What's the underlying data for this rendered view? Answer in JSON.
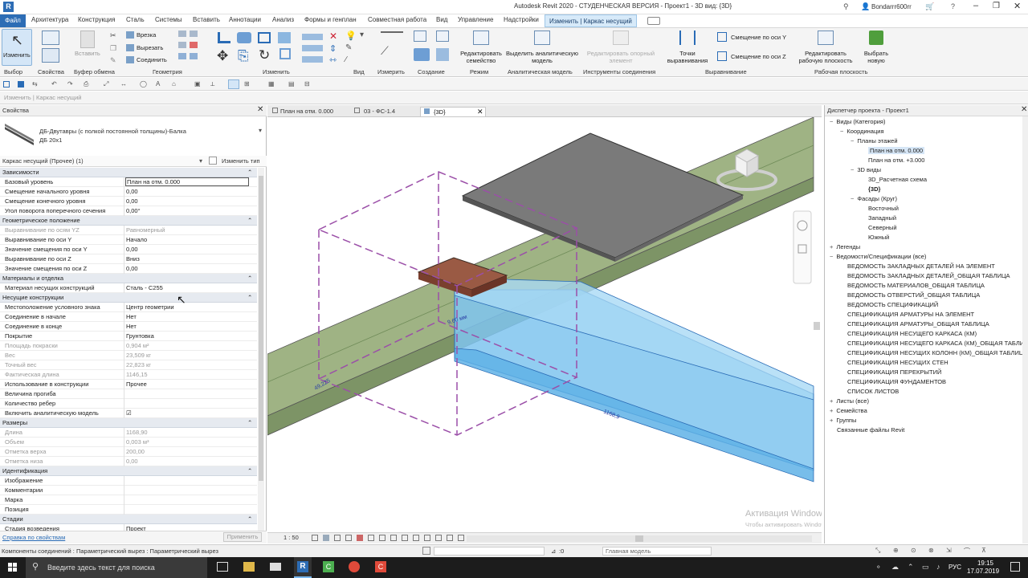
{
  "titlebar": {
    "title": "Autodesk Revit 2020 - СТУДЕНЧЕСКАЯ ВЕРСИЯ - Проект1 - 3D вид: {3D}",
    "user": "Bondarrr600rr"
  },
  "menu": {
    "file": "Файл",
    "items": [
      "Архитектура",
      "Конструкция",
      "Сталь",
      "Системы",
      "Вставить",
      "Аннотации",
      "Анализ",
      "Формы и генплан",
      "Совместная работа",
      "Вид",
      "Управление",
      "Надстройки"
    ],
    "active": "Изменить | Каркас несущий"
  },
  "ribbon": {
    "modify": "Изменить",
    "paste": "Вставить",
    "cut": "Врезка",
    "cut_out": "Вырезать",
    "join": "Соединить",
    "edit_family": "Редактировать семейство",
    "analytical": "Выделить аналитическую модель",
    "edit_support": "Редактировать опорный элемент",
    "align_points": "Точки выравнивания",
    "offset_y": "Смещение по оси Y",
    "offset_z": "Смещение по оси Z",
    "edit_workplane": "Редактировать рабочую плоскость",
    "pick_new": "Выбрать новую",
    "groups": [
      "Выбор",
      "Свойства",
      "Буфер обмена",
      "Геометрия",
      "Изменить",
      "Вид",
      "Измерить",
      "Создание",
      "Режим",
      "Аналитическая модель",
      "Инструменты соединения",
      "Выравнивание",
      "Рабочая плоскость"
    ]
  },
  "context_bar": "Изменить | Каркас несущий",
  "properties": {
    "title": "Свойства",
    "family_name": "ДБ-Двутавры (с полкой постоянной толщины)-Балка",
    "type_name": "ДБ 20x1",
    "selector": "Каркас несущий (Прочее) (1)",
    "edit_type": "Изменить тип",
    "link": "Справка по свойствам",
    "apply": "Применить",
    "sections": [
      {
        "title": "Зависимости",
        "rows": [
          [
            "Базовый уровень",
            "План на отм. 0.000",
            false
          ],
          [
            "Смещение начального уровня",
            "0,00",
            false
          ],
          [
            "Смещение конечного уровня",
            "0,00",
            false
          ],
          [
            "Угол поворота поперечного сечения",
            "0,00°",
            false
          ]
        ]
      },
      {
        "title": "Геометрическое положение",
        "rows": [
          [
            "Выравнивание по осям YZ",
            "Равномерный",
            true
          ],
          [
            "Выравнивание по оси Y",
            "Начало",
            false
          ],
          [
            "Значение смещения по оси Y",
            "0,00",
            false
          ],
          [
            "Выравнивание по оси Z",
            "Вниз",
            false
          ],
          [
            "Значение смещения по оси Z",
            "0,00",
            false
          ]
        ]
      },
      {
        "title": "Материалы и отделка",
        "rows": [
          [
            "Материал несущих конструкций",
            "Сталь - С255",
            false
          ]
        ]
      },
      {
        "title": "Несущие конструкции",
        "rows": [
          [
            "Местоположение условного знака",
            "Центр геометрии",
            false
          ],
          [
            "Соединение в начале",
            "Нет",
            false
          ],
          [
            "Соединение в конце",
            "Нет",
            false
          ],
          [
            "Покрытие",
            "Грунтовка",
            false
          ],
          [
            "Площадь покраски",
            "0,904 м²",
            true
          ],
          [
            "Вес",
            "23,509 кг",
            true
          ],
          [
            "Точный вес",
            "22,823 кг",
            true
          ],
          [
            "Фактическая длина",
            "1146,15",
            true
          ],
          [
            "Использование в конструкции",
            "Прочее",
            false
          ],
          [
            "Величина прогиба",
            "",
            false
          ],
          [
            "Количество ребер",
            "",
            false
          ],
          [
            "Включить аналитическую модель",
            "☑",
            false
          ]
        ]
      },
      {
        "title": "Размеры",
        "rows": [
          [
            "Длина",
            "1168,90",
            true
          ],
          [
            "Объем",
            "0,003 м³",
            true
          ],
          [
            "Отметка верха",
            "200,00",
            true
          ],
          [
            "Отметка низа",
            "0,00",
            true
          ]
        ]
      },
      {
        "title": "Идентификация",
        "rows": [
          [
            "Изображение",
            "",
            false
          ],
          [
            "Комментарии",
            "",
            false
          ],
          [
            "Марка",
            "",
            false
          ],
          [
            "Позиция",
            "",
            false
          ]
        ]
      },
      {
        "title": "Стадии",
        "rows": [
          [
            "Стадия возведения",
            "Проект",
            false
          ]
        ]
      }
    ]
  },
  "view_tabs": [
    "План на отм. 0.000",
    "03 - ФС-1.4",
    "{3D}"
  ],
  "view": {
    "dim1": "9,60 мм",
    "dim2": "1168,9",
    "dim3": "49,225",
    "scale": "1 : 50",
    "watermark_title": "Активация Windows",
    "watermark_text": "Чтобы активировать Windows, перейдите в раздел \"Параметры\"."
  },
  "browser": {
    "title": "Диспетчер проекта - Проект1",
    "items": [
      {
        "t": "Виды (Категория)",
        "l": 0,
        "ex": "−"
      },
      {
        "t": "Координация",
        "l": 1,
        "ex": "−"
      },
      {
        "t": "Планы этажей",
        "l": 2,
        "ex": "−"
      },
      {
        "t": "План на отм. 0.000",
        "l": 3,
        "ex": "",
        "sel": true
      },
      {
        "t": "План на отм. +3.000",
        "l": 3,
        "ex": ""
      },
      {
        "t": "3D виды",
        "l": 2,
        "ex": "−"
      },
      {
        "t": "3D_Расчетная схема",
        "l": 3,
        "ex": ""
      },
      {
        "t": "{3D}",
        "l": 3,
        "ex": "",
        "bold": true
      },
      {
        "t": "Фасады (Круг)",
        "l": 2,
        "ex": "−"
      },
      {
        "t": "Восточный",
        "l": 3,
        "ex": ""
      },
      {
        "t": "Западный",
        "l": 3,
        "ex": ""
      },
      {
        "t": "Северный",
        "l": 3,
        "ex": ""
      },
      {
        "t": "Южный",
        "l": 3,
        "ex": ""
      },
      {
        "t": "Легенды",
        "l": 0,
        "ex": "+"
      },
      {
        "t": "Ведомости/Спецификации (все)",
        "l": 0,
        "ex": "−"
      },
      {
        "t": "ВЕДОМОСТЬ ЗАКЛАДНЫХ ДЕТАЛЕЙ НА ЭЛЕМЕНТ",
        "l": 1,
        "ex": ""
      },
      {
        "t": "ВЕДОМОСТЬ ЗАКЛАДНЫХ ДЕТАЛЕЙ_ОБЩАЯ ТАБЛИЦА",
        "l": 1,
        "ex": ""
      },
      {
        "t": "ВЕДОМОСТЬ МАТЕРИАЛОВ_ОБЩАЯ ТАБЛИЦА",
        "l": 1,
        "ex": ""
      },
      {
        "t": "ВЕДОМОСТЬ ОТВЕРСТИЙ_ОБЩАЯ ТАБЛИЦА",
        "l": 1,
        "ex": ""
      },
      {
        "t": "ВЕДОМОСТЬ СПЕЦИФИКАЦИЙ",
        "l": 1,
        "ex": ""
      },
      {
        "t": "СПЕЦИФИКАЦИЯ АРМАТУРЫ НА ЭЛЕМЕНТ",
        "l": 1,
        "ex": ""
      },
      {
        "t": "СПЕЦИФИКАЦИЯ АРМАТУРЫ_ОБЩАЯ ТАБЛИЦА",
        "l": 1,
        "ex": ""
      },
      {
        "t": "СПЕЦИФИКАЦИЯ НЕСУЩЕГО КАРКАСА (КМ)",
        "l": 1,
        "ex": ""
      },
      {
        "t": "СПЕЦИФИКАЦИЯ НЕСУЩЕГО КАРКАСА (КМ)_ОБЩАЯ ТАБЛИЦА",
        "l": 1,
        "ex": ""
      },
      {
        "t": "СПЕЦИФИКАЦИЯ НЕСУЩИХ КОЛОНН (КМ)_ОБЩАЯ ТАБЛИЦА",
        "l": 1,
        "ex": ""
      },
      {
        "t": "СПЕЦИФИКАЦИЯ НЕСУЩИХ СТЕН",
        "l": 1,
        "ex": ""
      },
      {
        "t": "СПЕЦИФИКАЦИЯ ПЕРЕКРЫТИЙ",
        "l": 1,
        "ex": ""
      },
      {
        "t": "СПЕЦИФИКАЦИЯ ФУНДАМЕНТОВ",
        "l": 1,
        "ex": ""
      },
      {
        "t": "СПИСОК ЛИСТОВ",
        "l": 1,
        "ex": ""
      },
      {
        "t": "Листы (все)",
        "l": 0,
        "ex": "+"
      },
      {
        "t": "Семейства",
        "l": 0,
        "ex": "+"
      },
      {
        "t": "Группы",
        "l": 0,
        "ex": "+"
      },
      {
        "t": "Связанные файлы Revit",
        "l": 0,
        "ex": ""
      }
    ]
  },
  "status": {
    "text": "Компоненты соединений : Параметрический вырез : Параметрический вырез",
    "count": ":0",
    "model": "Главная модель"
  },
  "taskbar": {
    "search": "Введите здесь текст для поиска",
    "lang": "РУС",
    "time": "19:15",
    "date": "17.07.2019"
  },
  "colors": {
    "accent": "#2b6cb0",
    "beam_green": "#9fb384",
    "beam_blue": "#7fc4ee",
    "purple": "#9b4fa8"
  }
}
